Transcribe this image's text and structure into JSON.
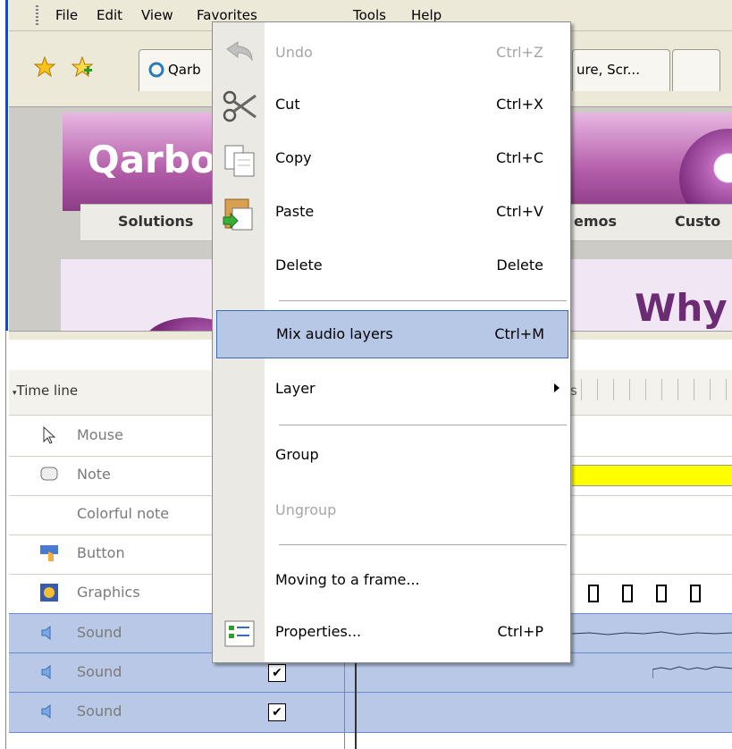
{
  "menubar": {
    "items": [
      "File",
      "Edit",
      "View",
      "Favorites",
      "Tools",
      "Help"
    ]
  },
  "browser": {
    "tabs": [
      {
        "label": "Qarb"
      },
      {
        "label": "ure, Scr..."
      }
    ]
  },
  "webpage": {
    "logo": "Qarbo",
    "nav": [
      "Solutions",
      "emos",
      "Custo"
    ],
    "headline": "Why ("
  },
  "timeline": {
    "header_label": "Time line",
    "header_partial": "s",
    "rows": [
      {
        "label": "Mouse",
        "icon": "cursor-icon"
      },
      {
        "label": "Note",
        "icon": "note-icon"
      },
      {
        "label": "Colorful note",
        "icon": ""
      },
      {
        "label": "Button",
        "icon": "button-icon"
      },
      {
        "label": "Graphics",
        "icon": "graphics-icon"
      },
      {
        "label": "Sound",
        "icon": "speaker-icon",
        "checked": false
      },
      {
        "label": "Sound",
        "icon": "speaker-icon",
        "checked": true
      },
      {
        "label": "Sound",
        "icon": "speaker-icon",
        "checked": true
      }
    ],
    "note_bar_color": "#ffff00",
    "selection_color": "#b8c8e6"
  },
  "context_menu": {
    "items": {
      "undo": {
        "label": "Undo",
        "shortcut": "Ctrl+Z",
        "disabled": true,
        "icon": "undo-icon"
      },
      "cut": {
        "label": "Cut",
        "shortcut": "Ctrl+X",
        "icon": "scissors-icon"
      },
      "copy": {
        "label": "Copy",
        "shortcut": "Ctrl+C",
        "icon": "copy-icon"
      },
      "paste": {
        "label": "Paste",
        "shortcut": "Ctrl+V",
        "icon": "paste-icon"
      },
      "delete": {
        "label": "Delete",
        "shortcut": "Delete"
      },
      "mix": {
        "label": "Mix audio layers",
        "shortcut": "Ctrl+M",
        "highlighted": true
      },
      "layer": {
        "label": "Layer",
        "submenu": true
      },
      "group": {
        "label": "Group"
      },
      "ungroup": {
        "label": "Ungroup",
        "disabled": true
      },
      "moving": {
        "label": "Moving to a frame..."
      },
      "properties": {
        "label": "Properties...",
        "shortcut": "Ctrl+P",
        "icon": "properties-icon"
      }
    },
    "highlight_color": "#b6c8e6"
  }
}
